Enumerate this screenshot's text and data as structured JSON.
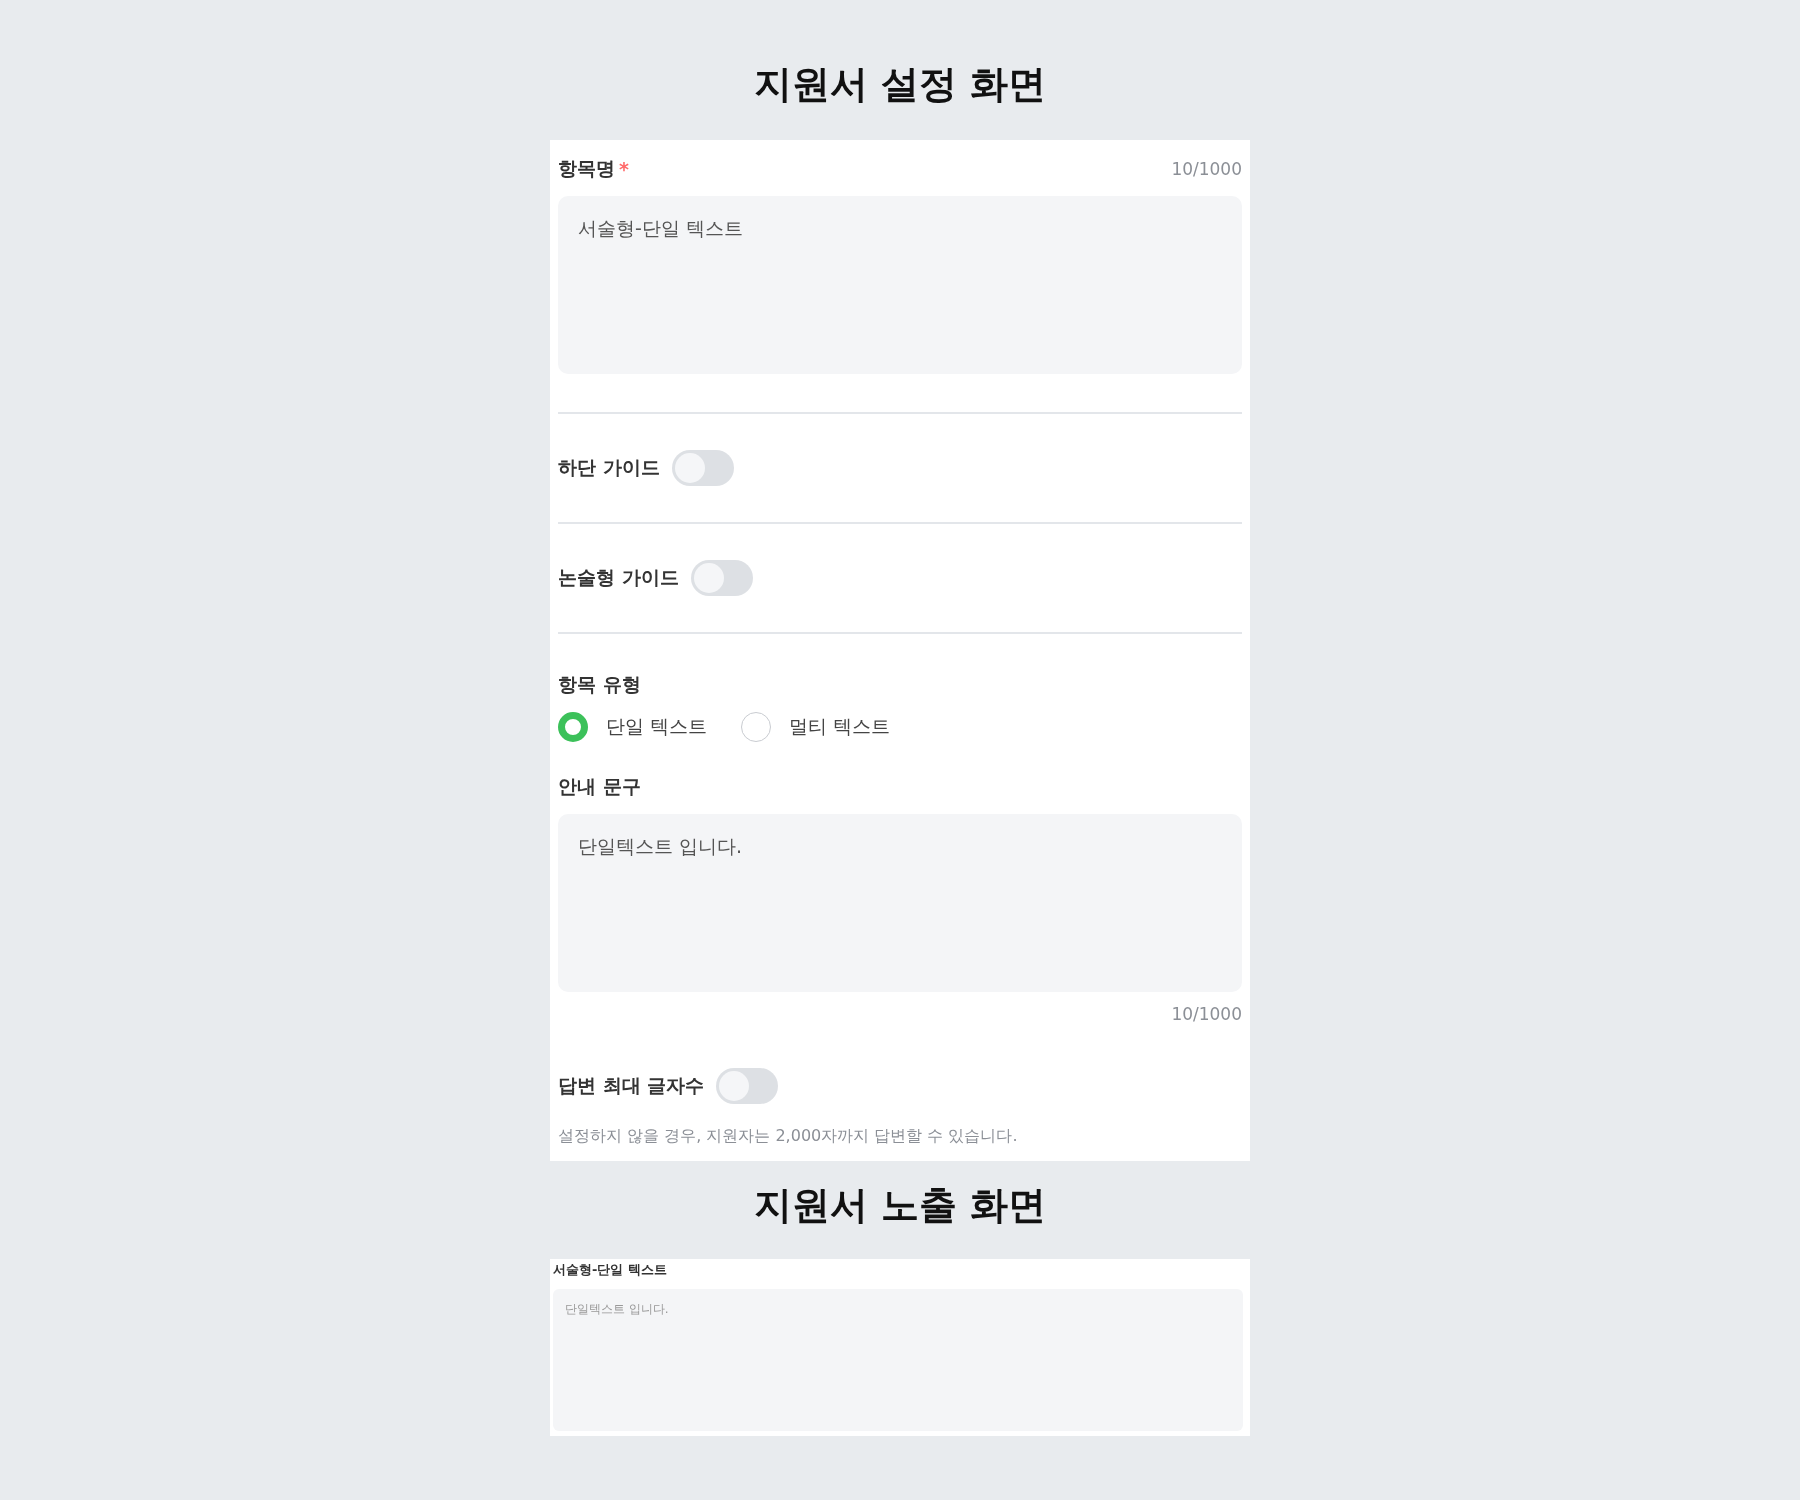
{
  "settings_title": "지원서 설정 화면",
  "settings": {
    "fields": [
      {
        "kind": "title_field",
        "label": "항목명",
        "required_mark": "*",
        "counter": "10/1000",
        "value": "서술형-단일 텍스트",
        "divider": true
      },
      {
        "kind": "toggle",
        "label": "하단 가이드",
        "on": false,
        "divider": true
      },
      {
        "kind": "toggle",
        "label": "논술형 가이드",
        "on": false,
        "divider": true
      },
      {
        "kind": "radio",
        "label": "항목 유형",
        "divider": false,
        "options": [
          {
            "label": "단일 텍스트",
            "selected": true
          },
          {
            "label": "멀티 텍스트",
            "selected": false
          }
        ]
      },
      {
        "kind": "text_field",
        "label": "안내 문구",
        "value": "단일텍스트 입니다.",
        "counter": "10/1000",
        "divider": false
      },
      {
        "kind": "toggle",
        "label": "답변 최대 글자수",
        "on": false,
        "hint": "설정하지 않을 경우, 지원자는 2,000자까지 답변할 수 있습니다.",
        "divider": false
      }
    ]
  },
  "preview_title": "지원서 노출 화면",
  "preview": {
    "label": "서술형-단일 텍스트",
    "placeholder": "단일텍스트 입니다."
  }
}
